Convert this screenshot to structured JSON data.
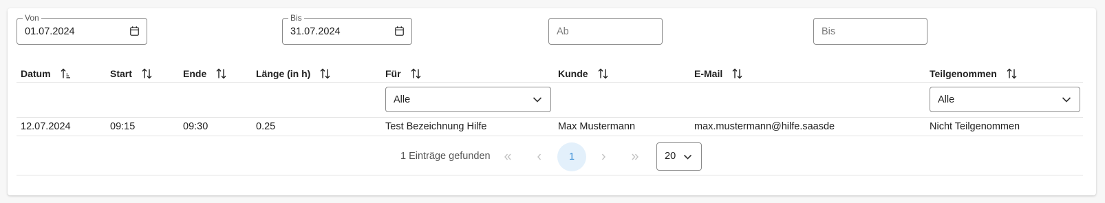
{
  "filters": {
    "von": {
      "legend": "Von",
      "value": "01.07.2024"
    },
    "bis": {
      "legend": "Bis",
      "value": "31.07.2024"
    },
    "ab_placeholder": "Ab",
    "bis2_placeholder": "Bis"
  },
  "table": {
    "columns": [
      "Datum",
      "Start",
      "Ende",
      "Länge (in h)",
      "Für",
      "Kunde",
      "E-Mail",
      "Teilgenommen"
    ],
    "filters": {
      "fuer": "Alle",
      "teilgenommen": "Alle"
    },
    "rows": [
      [
        "12.07.2024",
        "09:15",
        "09:30",
        "0.25",
        "Test Bezeichnung Hilfe",
        "Max Mustermann",
        "max.mustermann@hilfe.saasde",
        "Nicht Teilgenommen"
      ]
    ]
  },
  "pagination": {
    "count_text": "1 Einträge gefunden",
    "current_page": "1",
    "page_size": "20"
  },
  "icons": {
    "calendar": "calendar-icon",
    "sort": "sort-icon",
    "sort_active": "sort-ascending-icon",
    "chevron": "chevron-down-icon",
    "first": "first-page-icon",
    "prev": "previous-page-icon",
    "next": "next-page-icon",
    "last": "last-page-icon"
  },
  "colors": {
    "accent": "#3b8fd6",
    "accent_bg": "#e3f0fb",
    "border": "#8a8a8a",
    "divider": "#e3e3e3"
  }
}
